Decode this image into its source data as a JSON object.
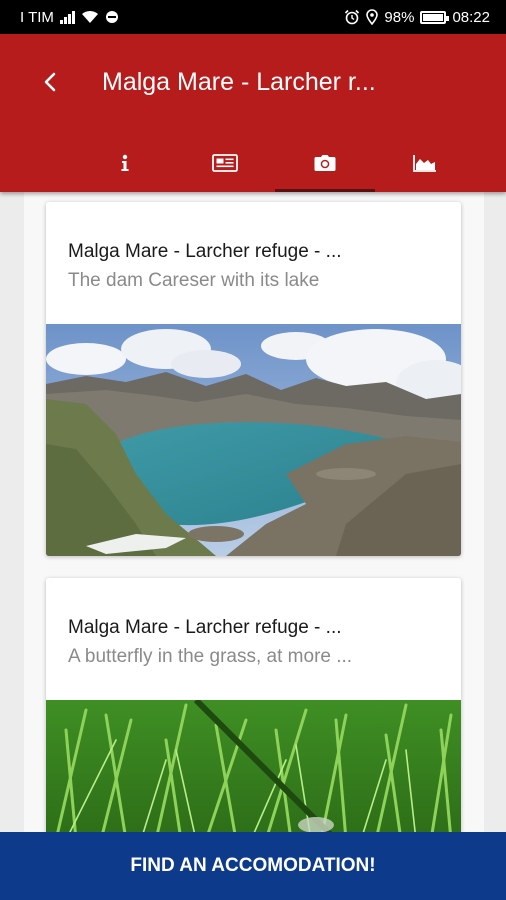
{
  "status_bar": {
    "carrier": "I TIM",
    "battery": "98%",
    "battery_level": 0.98,
    "time": "08:22",
    "icons": [
      "signal-icon",
      "wifi-icon",
      "data-saver-icon",
      "alarm-icon",
      "location-icon",
      "battery-icon"
    ]
  },
  "app_bar": {
    "title": "Malga Mare - Larcher r...",
    "back_icon": "chevron-left-icon",
    "color": "#b71c1c"
  },
  "tabs": [
    {
      "name": "info",
      "icon": "info-icon",
      "active": false
    },
    {
      "name": "news",
      "icon": "newspaper-icon",
      "active": false
    },
    {
      "name": "photos",
      "icon": "camera-icon",
      "active": true
    },
    {
      "name": "elevation",
      "icon": "elevation-chart-icon",
      "active": false
    }
  ],
  "cards": [
    {
      "title": "Malga Mare - Larcher refuge - ...",
      "subtitle": "The dam Careser with its lake",
      "image": "mountain-lake-photo"
    },
    {
      "title": "Malga Mare - Larcher refuge - ...",
      "subtitle": "A butterfly in the grass, at more ...",
      "image": "grass-photo"
    }
  ],
  "cta": {
    "label": "FIND AN ACCOMODATION!",
    "color": "#0d3a8a"
  }
}
